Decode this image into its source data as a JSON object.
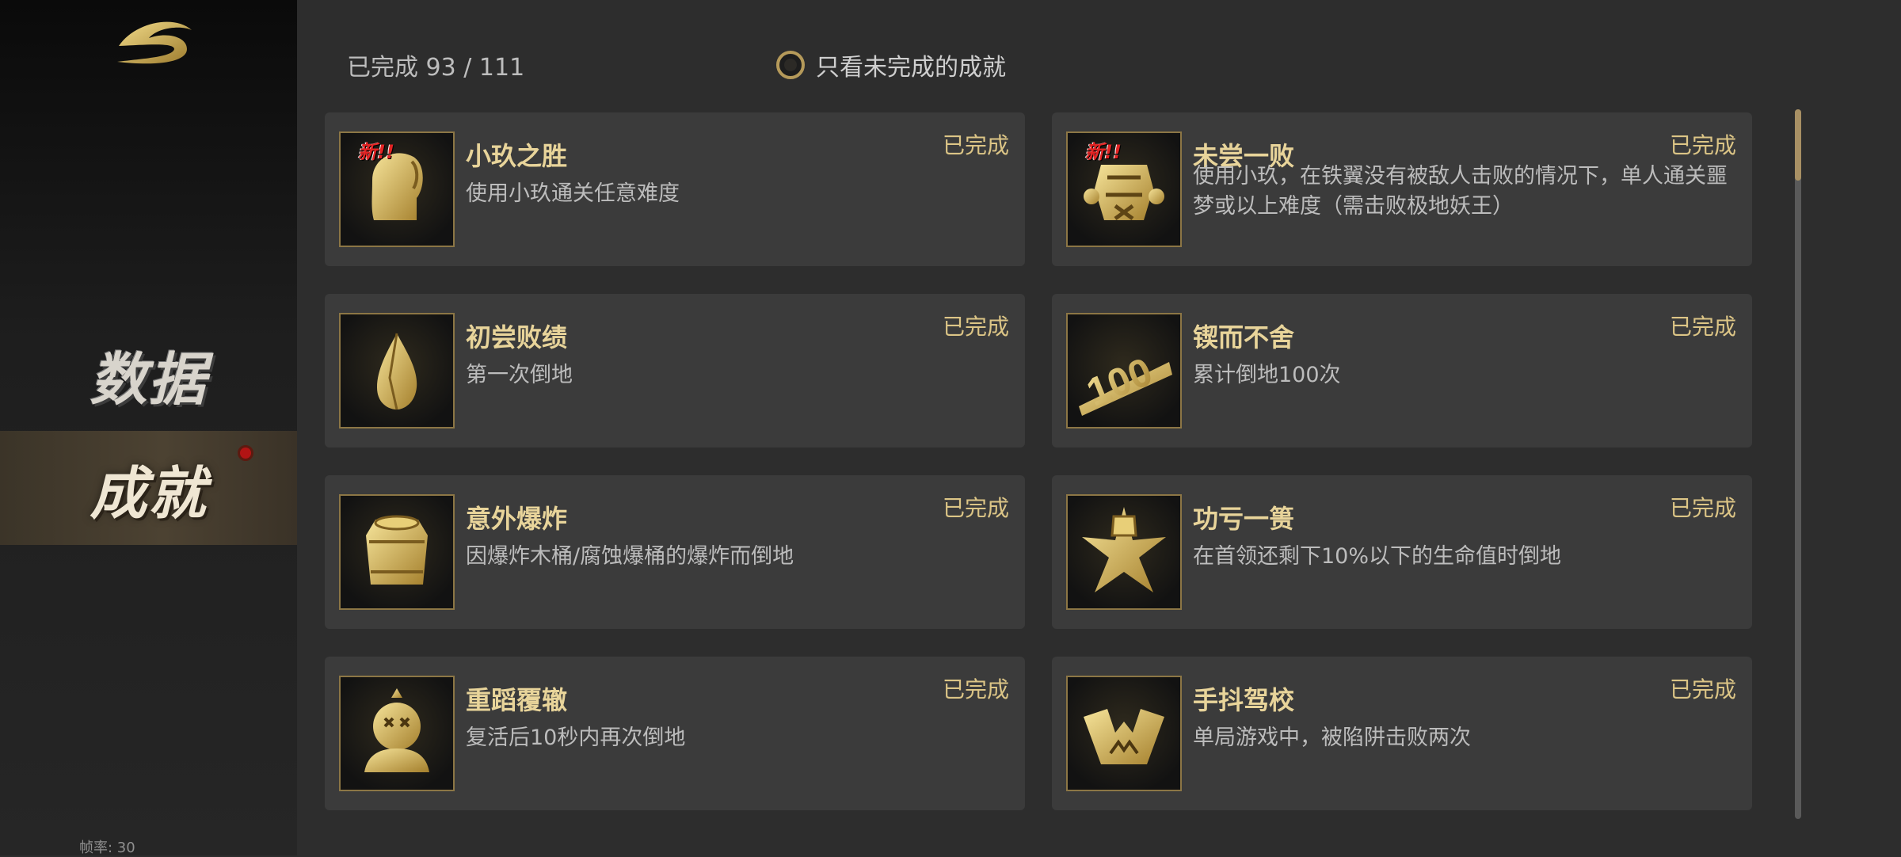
{
  "sidebar": {
    "items": [
      {
        "label": "数据",
        "selected": false
      },
      {
        "label": "成就",
        "selected": true,
        "notification": true
      }
    ],
    "fps_label": "帧率: 30"
  },
  "header": {
    "progress": "已完成 93 / 111",
    "filter_label": "只看未完成的成就",
    "filter_checked": false
  },
  "achievements": [
    {
      "title": "小玖之胜",
      "desc": "使用小玖通关任意难度",
      "status": "已完成",
      "new_tag": "新!!",
      "icon": "head-icon"
    },
    {
      "title": "未尝一败",
      "desc": "使用小玖，在铁翼没有被敌人击败的情况下，单人通关噩梦或以上难度（需击败极地妖王）",
      "status": "已完成",
      "new_tag": "新!!",
      "icon": "armor-icon"
    },
    {
      "title": "初尝败绩",
      "desc": "第一次倒地",
      "status": "已完成",
      "new_tag": "",
      "icon": "drop-icon"
    },
    {
      "title": "锲而不舍",
      "desc": "累计倒地100次",
      "status": "已完成",
      "new_tag": "",
      "icon": "hundred-icon"
    },
    {
      "title": "意外爆炸",
      "desc": "因爆炸木桶/腐蚀爆桶的爆炸而倒地",
      "status": "已完成",
      "new_tag": "",
      "icon": "barrel-icon"
    },
    {
      "title": "功亏一篑",
      "desc": "在首领还剩下10%以下的生命值时倒地",
      "status": "已完成",
      "new_tag": "",
      "icon": "burst-icon"
    },
    {
      "title": "重蹈覆辙",
      "desc": "复活后10秒内再次倒地",
      "status": "已完成",
      "new_tag": "",
      "icon": "ko-figure-icon"
    },
    {
      "title": "手抖驾校",
      "desc": "单局游戏中，被陷阱击败两次",
      "status": "已完成",
      "new_tag": "",
      "icon": "trap-icon"
    }
  ],
  "colors": {
    "accent_gold": "#e8d49a",
    "status_gold": "#dcc586",
    "new_red": "#e32424"
  }
}
